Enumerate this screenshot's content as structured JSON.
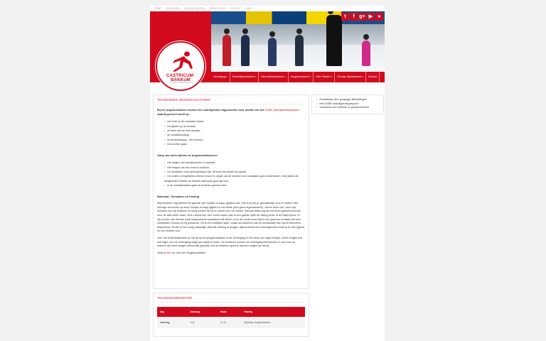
{
  "topline": [
    "HOME",
    "VERENIGING",
    "JEUGDSCHAATSEN",
    "WEDSTRIJDEN",
    "CONTACT",
    "LINKS"
  ],
  "logo": {
    "name": "CASTRICUM-BAKKUM",
    "sub1": "IJSVERENIGING",
    "sub2": "SCHAATSVERENIGING"
  },
  "social": [
    "twitter-icon",
    "facebook-icon",
    "google-plus-icon",
    "youtube-icon",
    "flickr-icon"
  ],
  "social_glyphs": [
    "t",
    "f",
    "g+",
    "▶",
    "●"
  ],
  "nav": [
    {
      "label": "Vereniging",
      "dropdown": true
    },
    {
      "label": "Wedstrijdschaatsen",
      "dropdown": true
    },
    {
      "label": "Recreatieschaatsen",
      "dropdown": true
    },
    {
      "label": "Jeugdschaatsen",
      "dropdown": true
    },
    {
      "label": "Allee Skaten",
      "dropdown": true
    },
    {
      "label": "Overige Sportaanbod",
      "dropdown": true
    },
    {
      "label": "Contact",
      "dropdown": false
    }
  ],
  "main": {
    "title": "TRAININGEN JEUGDSCHAATSEN",
    "intro_1": "Bij het jeugdschaatsen worden hun vaardigheden bijgehouden door middel van het ",
    "intro_link": "KNSB Vaardigheidspaspoort",
    "intro_2": ", waarbij geleerd wordt op:",
    "skills": [
      "het recht op de schaatsen staan;",
      "het glijden op de schaats;",
      "de afzet met de hele schaats;",
      "de schaatshouding;",
      "de armbeweging – het remmen;",
      "het bochten gaan."
    ],
    "rules_title": "Gang van zaken tijdens de jeugdschaatslessen",
    "rules": [
      "Het dragen van handschoenen is verplicht.",
      "Het dragen van een muts is verplicht.",
      "De schaatsen moet goed geslepen zijn, dit komt het plezier ten goede.",
      "De ouders of begeleiders dienen ervoor te zorgen dat de kinderen een schaatsen goed onderbinden. Ook tijdens de lesbijkheden hebben de trainers daar bijna geen tijd voor.",
      "In de schaatskantine gaan de kinderen gewoon door."
    ],
    "material_title": "Materiaal / Schaatsen en Kleding",
    "material_text": "Wij beveelen nog steeds het gebruik van houtjes of easy- glijders aan. Dat it bij het jo. gemakkelijk voor te maken. Met dunnige schoenen op deze houtjes of easy-glijders is het beste (dus geen regenlaarzen!). Noren leren niet, door zijn meestal voor de kinderen te hoog komen het al en doorlt voor de enkels. Dat kan altijd nog als het leren gedeelveerende voor de skill meter baan. Wilt u dimst wel, een noren kopen dan is een goede optie de Viking junior of de Raps junior. Er zijn verder ook diverse (veel begonnende schaatsers die leeren voor de combi-noor Dat is een gewone schaats met een verstelbare schoen uit bij jeboshow. Dit is een redelijke optie, maak het aanleren van de schaatsstijl dan wordt freemens beperkend. Verder is het nodig makkelijk, zittende kleding te dragen. Bijvoorbeeld een trainingsbroek hoeft al te veel jigsent en een redeem trui.",
    "insurance_text": "Voor het trekenbaanheid op het ijs bij het jeugdschaatsen is de vereniging in het bezit van eigen fenges. Deze fenges met zelf eigen van de vereniging krijgt aan bakje te lezen. De kinderen kunnen de vereniging betrekenen en ook voor de trainers zijn deze fenges afleveralls geschikt om de kinderen goed te kunnen volgen op het ijs.",
    "closing_1": "Geef je ",
    "closing_link": "hier",
    "closing_2": " op voor het Jeugdschaatsen"
  },
  "aside": {
    "links": [
      "Schaatstips dmv grappige afbeeldingen",
      "Het KNSB Vaardigheidspaspoort",
      "Voorbeeld van oefenen in groepsverband"
    ]
  },
  "schedule": {
    "title": "TRAININGSROOSTER",
    "headers": [
      "Dag",
      "Aanvang",
      "Einde",
      "Training"
    ],
    "rows": [
      [
        "Zaterdag",
        "9:45",
        "11:15",
        "Opleiding Jeugdschaatsen"
      ]
    ]
  },
  "colors": {
    "accent": "#d20a1e",
    "page_bg": "#f2f2f2"
  }
}
